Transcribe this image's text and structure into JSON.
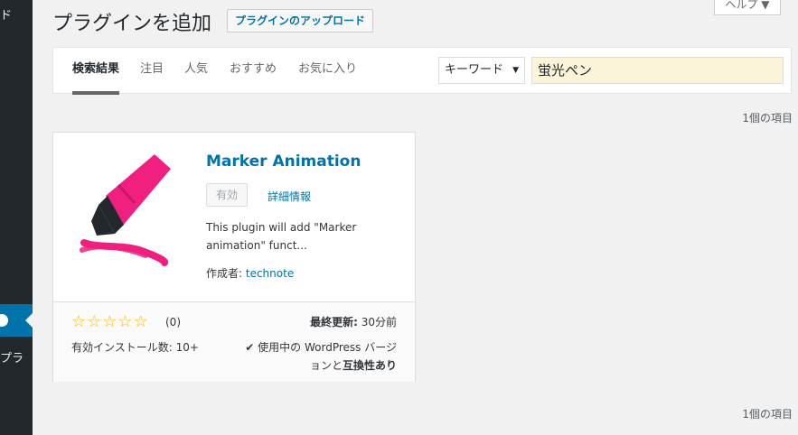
{
  "sidebar": {
    "top_text": "ド",
    "bottom_text": "プラ"
  },
  "header": {
    "title": "プラグインを追加",
    "upload_button": "プラグインのアップロード",
    "help_tab": "ヘルプ ▼"
  },
  "filter": {
    "tabs": [
      {
        "label": "検索結果",
        "current": true
      },
      {
        "label": "注目"
      },
      {
        "label": "人気"
      },
      {
        "label": "おすすめ"
      },
      {
        "label": "お気に入り"
      }
    ],
    "search_type": "キーワード",
    "search_value": "蛍光ペン"
  },
  "results": {
    "count_top": "1個の項目",
    "count_bottom": "1個の項目"
  },
  "plugin": {
    "name": "Marker Animation",
    "active_label": "有効",
    "details_label": "詳細情報",
    "description": "This plugin will add \"Marker animation\" funct...",
    "author_prefix": "作成者:",
    "author_name": "technote",
    "rating_count": "(0)",
    "stars_filled": 0,
    "installs": "有効インストール数: 10+",
    "last_updated_label": "最終更新:",
    "last_updated_value": "30分前",
    "compat_check": "✔",
    "compat_text_1": "使用中の WordPress バージ",
    "compat_text_2": "ョンと",
    "compat_text_bold": "互換性あり",
    "icon_colors": {
      "body": "#ef2080",
      "tip": "#23282d"
    }
  }
}
